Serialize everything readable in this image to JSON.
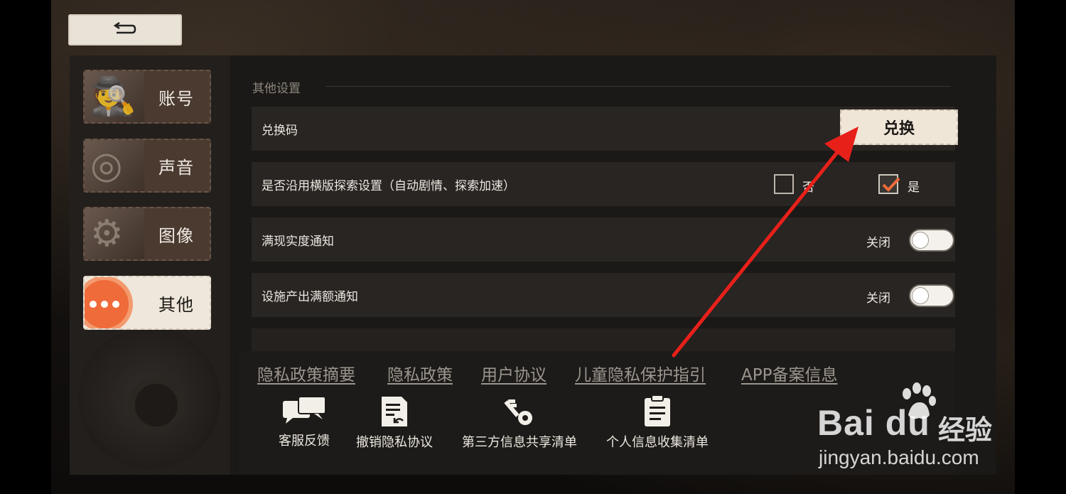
{
  "nav": {
    "back_icon": "return-arrow-icon",
    "menu": [
      {
        "label": "账号",
        "icon": "detective-icon",
        "active": false
      },
      {
        "label": "声音",
        "icon": "turntable-icon",
        "active": false
      },
      {
        "label": "图像",
        "icon": "film-camera-icon",
        "active": false
      },
      {
        "label": "其他",
        "icon": "more-dots-icon",
        "active": true
      }
    ]
  },
  "settings": {
    "section_title": "其他设置",
    "redeem": {
      "label": "兑换码",
      "button": "兑换"
    },
    "explore": {
      "label": "是否沿用横版探索设置（自动剧情、探索加速）",
      "option_no": "否",
      "option_yes": "是",
      "selected": "是"
    },
    "notify_full": {
      "label": "满现实度通知",
      "state": "关闭"
    },
    "notify_facility": {
      "label": "设施产出满额通知",
      "state": "关闭"
    }
  },
  "footer": {
    "links": [
      "隐私政策摘要",
      "隐私政策",
      "用户协议",
      "儿童隐私保护指引",
      "APP备案信息"
    ],
    "tools": [
      {
        "label": "客服反馈",
        "icon": "chat-bubbles-icon"
      },
      {
        "label": "撤销隐私协议",
        "icon": "revoke-document-icon"
      },
      {
        "label": "第三方信息共享清单",
        "icon": "key-icon"
      },
      {
        "label": "个人信息收集清单",
        "icon": "clipboard-icon"
      }
    ]
  },
  "watermark": {
    "brand": "Bai du",
    "cn": "经验",
    "url": "jingyan.baidu.com"
  },
  "colors": {
    "accent_orange": "#ef6b3a",
    "annotation_red": "#e8201a",
    "checkbox_check": "#ef6b3a"
  }
}
